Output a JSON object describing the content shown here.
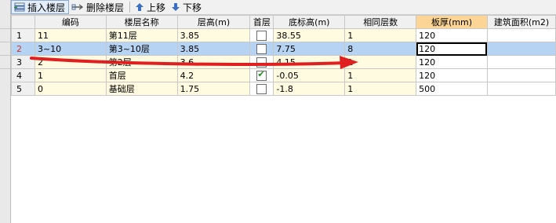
{
  "toolbar": {
    "insert_label": "插入楼层",
    "delete_label": "删除楼层",
    "up_label": "上移",
    "down_label": "下移"
  },
  "columns": [
    "编码",
    "楼层名称",
    "层高(m)",
    "首层",
    "底标高(m)",
    "相同层数",
    "板厚(mm)",
    "建筑面积(m2)"
  ],
  "rows": [
    {
      "num": "1",
      "code": "11",
      "name": "第11层",
      "height": "3.85",
      "first": false,
      "base": "38.55",
      "same": "1",
      "slab": "120",
      "area": ""
    },
    {
      "num": "2",
      "code": "3~10",
      "name": "第3~10层",
      "height": "3.85",
      "first": false,
      "base": "7.75",
      "same": "8",
      "slab": "120",
      "area": ""
    },
    {
      "num": "3",
      "code": "2",
      "name": "第2层",
      "height": "3.6",
      "first": false,
      "base": "4.15",
      "same": "1",
      "slab": "120",
      "area": ""
    },
    {
      "num": "4",
      "code": "1",
      "name": "首层",
      "height": "4.2",
      "first": true,
      "base": "-0.05",
      "same": "1",
      "slab": "120",
      "area": ""
    },
    {
      "num": "5",
      "code": "0",
      "name": "基础层",
      "height": "1.75",
      "first": false,
      "base": "-1.8",
      "same": "1",
      "slab": "500",
      "area": ""
    }
  ],
  "colors": {
    "selected_row": "#b7d3f4",
    "editable_cell": "#fffbe0",
    "highlight_header": "#fbd496",
    "annotation_arrow": "#e02020"
  }
}
